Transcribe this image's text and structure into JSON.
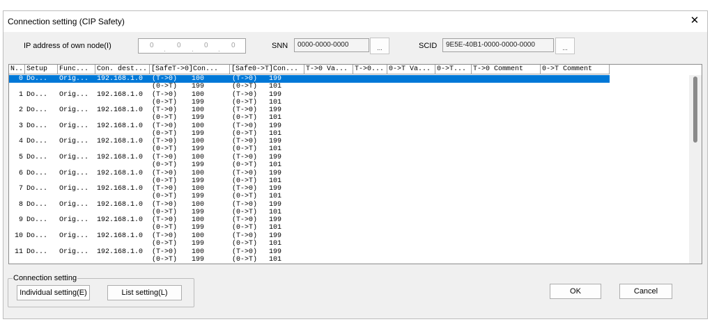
{
  "window": {
    "title": "Connection setting (CIP Safety)"
  },
  "top": {
    "ip_label": "IP address of own node(I)",
    "ip_octets": [
      "0",
      "0",
      "0",
      "0"
    ],
    "snn_label": "SNN",
    "snn_value": "0000-0000-0000",
    "scid_label": "SCID",
    "scid_value": "9E5E-40B1-0000-0000-0000",
    "browse_label": "..."
  },
  "grid": {
    "headers": [
      "N...",
      "Setup",
      "Func...",
      "Con. dest...",
      "[SafeT->0]Con...",
      "[Safe0->T]Con...",
      "T->0 Va...",
      "T->0...",
      "0->T Va...",
      "0->T...",
      "T->0 Comment",
      "0->T Comment"
    ],
    "rows": [
      {
        "no": "0",
        "setup": "Do...",
        "func": "Orig...",
        "dest": "192.168.1.0",
        "s1": [
          "(T->0)",
          "(0->T)"
        ],
        "v1": [
          "100",
          "199"
        ],
        "s2": [
          "(T->0)",
          "(0->T)"
        ],
        "v2": [
          "199",
          "101"
        ]
      },
      {
        "no": "1",
        "setup": "Do...",
        "func": "Orig...",
        "dest": "192.168.1.0",
        "s1": [
          "(T->0)",
          "(0->T)"
        ],
        "v1": [
          "100",
          "199"
        ],
        "s2": [
          "(T->0)",
          "(0->T)"
        ],
        "v2": [
          "199",
          "101"
        ]
      },
      {
        "no": "2",
        "setup": "Do...",
        "func": "Orig...",
        "dest": "192.168.1.0",
        "s1": [
          "(T->0)",
          "(0->T)"
        ],
        "v1": [
          "100",
          "199"
        ],
        "s2": [
          "(T->0)",
          "(0->T)"
        ],
        "v2": [
          "199",
          "101"
        ]
      },
      {
        "no": "3",
        "setup": "Do...",
        "func": "Orig...",
        "dest": "192.168.1.0",
        "s1": [
          "(T->0)",
          "(0->T)"
        ],
        "v1": [
          "100",
          "199"
        ],
        "s2": [
          "(T->0)",
          "(0->T)"
        ],
        "v2": [
          "199",
          "101"
        ]
      },
      {
        "no": "4",
        "setup": "Do...",
        "func": "Orig...",
        "dest": "192.168.1.0",
        "s1": [
          "(T->0)",
          "(0->T)"
        ],
        "v1": [
          "100",
          "199"
        ],
        "s2": [
          "(T->0)",
          "(0->T)"
        ],
        "v2": [
          "199",
          "101"
        ]
      },
      {
        "no": "5",
        "setup": "Do...",
        "func": "Orig...",
        "dest": "192.168.1.0",
        "s1": [
          "(T->0)",
          "(0->T)"
        ],
        "v1": [
          "100",
          "199"
        ],
        "s2": [
          "(T->0)",
          "(0->T)"
        ],
        "v2": [
          "199",
          "101"
        ]
      },
      {
        "no": "6",
        "setup": "Do...",
        "func": "Orig...",
        "dest": "192.168.1.0",
        "s1": [
          "(T->0)",
          "(0->T)"
        ],
        "v1": [
          "100",
          "199"
        ],
        "s2": [
          "(T->0)",
          "(0->T)"
        ],
        "v2": [
          "199",
          "101"
        ]
      },
      {
        "no": "7",
        "setup": "Do...",
        "func": "Orig...",
        "dest": "192.168.1.0",
        "s1": [
          "(T->0)",
          "(0->T)"
        ],
        "v1": [
          "100",
          "199"
        ],
        "s2": [
          "(T->0)",
          "(0->T)"
        ],
        "v2": [
          "199",
          "101"
        ]
      },
      {
        "no": "8",
        "setup": "Do...",
        "func": "Orig...",
        "dest": "192.168.1.0",
        "s1": [
          "(T->0)",
          "(0->T)"
        ],
        "v1": [
          "100",
          "199"
        ],
        "s2": [
          "(T->0)",
          "(0->T)"
        ],
        "v2": [
          "199",
          "101"
        ]
      },
      {
        "no": "9",
        "setup": "Do...",
        "func": "Orig...",
        "dest": "192.168.1.0",
        "s1": [
          "(T->0)",
          "(0->T)"
        ],
        "v1": [
          "100",
          "199"
        ],
        "s2": [
          "(T->0)",
          "(0->T)"
        ],
        "v2": [
          "199",
          "101"
        ]
      },
      {
        "no": "10",
        "setup": "Do...",
        "func": "Orig...",
        "dest": "192.168.1.0",
        "s1": [
          "(T->0)",
          "(0->T)"
        ],
        "v1": [
          "100",
          "199"
        ],
        "s2": [
          "(T->0)",
          "(0->T)"
        ],
        "v2": [
          "199",
          "101"
        ]
      },
      {
        "no": "11",
        "setup": "Do...",
        "func": "Orig...",
        "dest": "192.168.1.0",
        "s1": [
          "(T->0)",
          "(0->T)"
        ],
        "v1": [
          "100",
          "199"
        ],
        "s2": [
          "(T->0)",
          "(0->T)"
        ],
        "v2": [
          "199",
          "101"
        ]
      }
    ]
  },
  "connection_group": {
    "title": "Connection setting",
    "individual_label": "Individual setting(E)",
    "list_label": "List setting(L)"
  },
  "footer": {
    "ok_label": "OK",
    "cancel_label": "Cancel"
  },
  "colors": {
    "selection": "#0078d7",
    "dialog_bg": "#f0f0f0"
  }
}
